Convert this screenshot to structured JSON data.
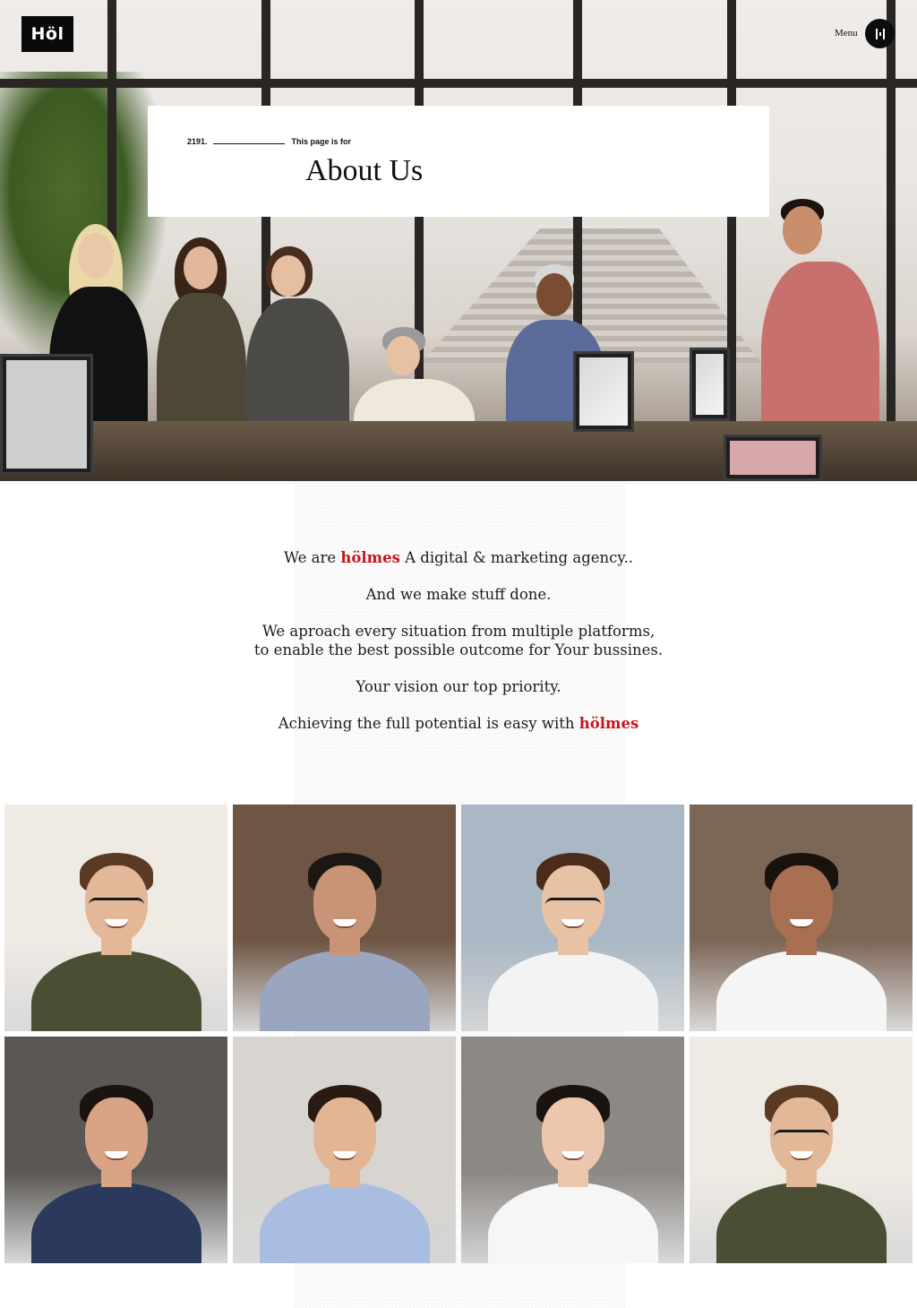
{
  "header": {
    "logo_text": "Höl",
    "menu_label": "Menu",
    "menu_icon": "hamburger-icon"
  },
  "hero": {
    "eyebrow_number": "2191.",
    "eyebrow_text": "This page is for",
    "title": "About Us"
  },
  "intro": {
    "line1_pre": "We are",
    "brand": "hölmes",
    "line1_post": "A digital & marketing agency..",
    "line2": "And we make stuff done.",
    "line3a": "We aproach every situation from multiple platforms,",
    "line3b": "to enable the best possible outcome for Your bussines.",
    "line4": "Your vision our top priority.",
    "line5_pre": "Achieving the full potential is easy with",
    "line5_brand": "hölmes"
  },
  "team": {
    "members": [
      {
        "shirt": "#4a4f33",
        "bg": "#efeae4",
        "hair": "#5a3a22",
        "glasses": true
      },
      {
        "shirt": "#9aa6bf",
        "bg": "#6e5544",
        "hair": "#1d1713",
        "glasses": false
      },
      {
        "shirt": "#f3f3f3",
        "bg": "#a9b8c4",
        "hair": "#4b2c1b",
        "glasses": true
      },
      {
        "shirt": "#f5f5f5",
        "bg": "#7c6656",
        "hair": "#1a120d",
        "glasses": false
      },
      {
        "shirt": "#2b3a5c",
        "bg": "#5a5754",
        "hair": "#1a1310",
        "glasses": false
      },
      {
        "shirt": "#a9bde0",
        "bg": "#d8d4cf",
        "hair": "#2a1b12",
        "glasses": false
      },
      {
        "shirt": "#f6f6f6",
        "bg": "#8c8884",
        "hair": "#1a1410",
        "glasses": false
      },
      {
        "shirt": "#4a4f33",
        "bg": "#efeae4",
        "hair": "#5a3a22",
        "glasses": true
      }
    ]
  },
  "colors": {
    "brand_red": "#c8161d",
    "logo_bg": "#0a0a0a"
  }
}
